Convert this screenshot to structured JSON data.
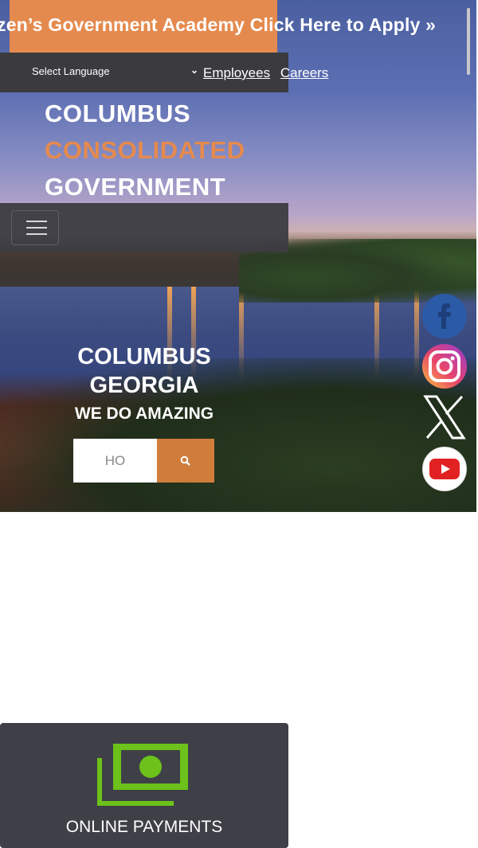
{
  "banner": {
    "text": "zen’s Government Academy Click Here to Apply »"
  },
  "topbar": {
    "language_label": "Select Language",
    "links": [
      "Employees",
      "Careers"
    ]
  },
  "brand": {
    "line1": "COLUMBUS",
    "line2": "CONSOLIDATED",
    "line3": "GOVERNMENT"
  },
  "hero": {
    "title_line1": "COLUMBUS",
    "title_line2": "GEORGIA",
    "subtitle": "WE DO AMAZING"
  },
  "search": {
    "value": "HO"
  },
  "social": [
    "facebook-icon",
    "instagram-icon",
    "x-icon",
    "youtube-icon"
  ],
  "card": {
    "label": "ONLINE PAYMENTS",
    "icon": "money-icon"
  },
  "colors": {
    "accent": "#e58a4e",
    "dark": "#3b3b3f",
    "money_green": "#6cc21a"
  }
}
